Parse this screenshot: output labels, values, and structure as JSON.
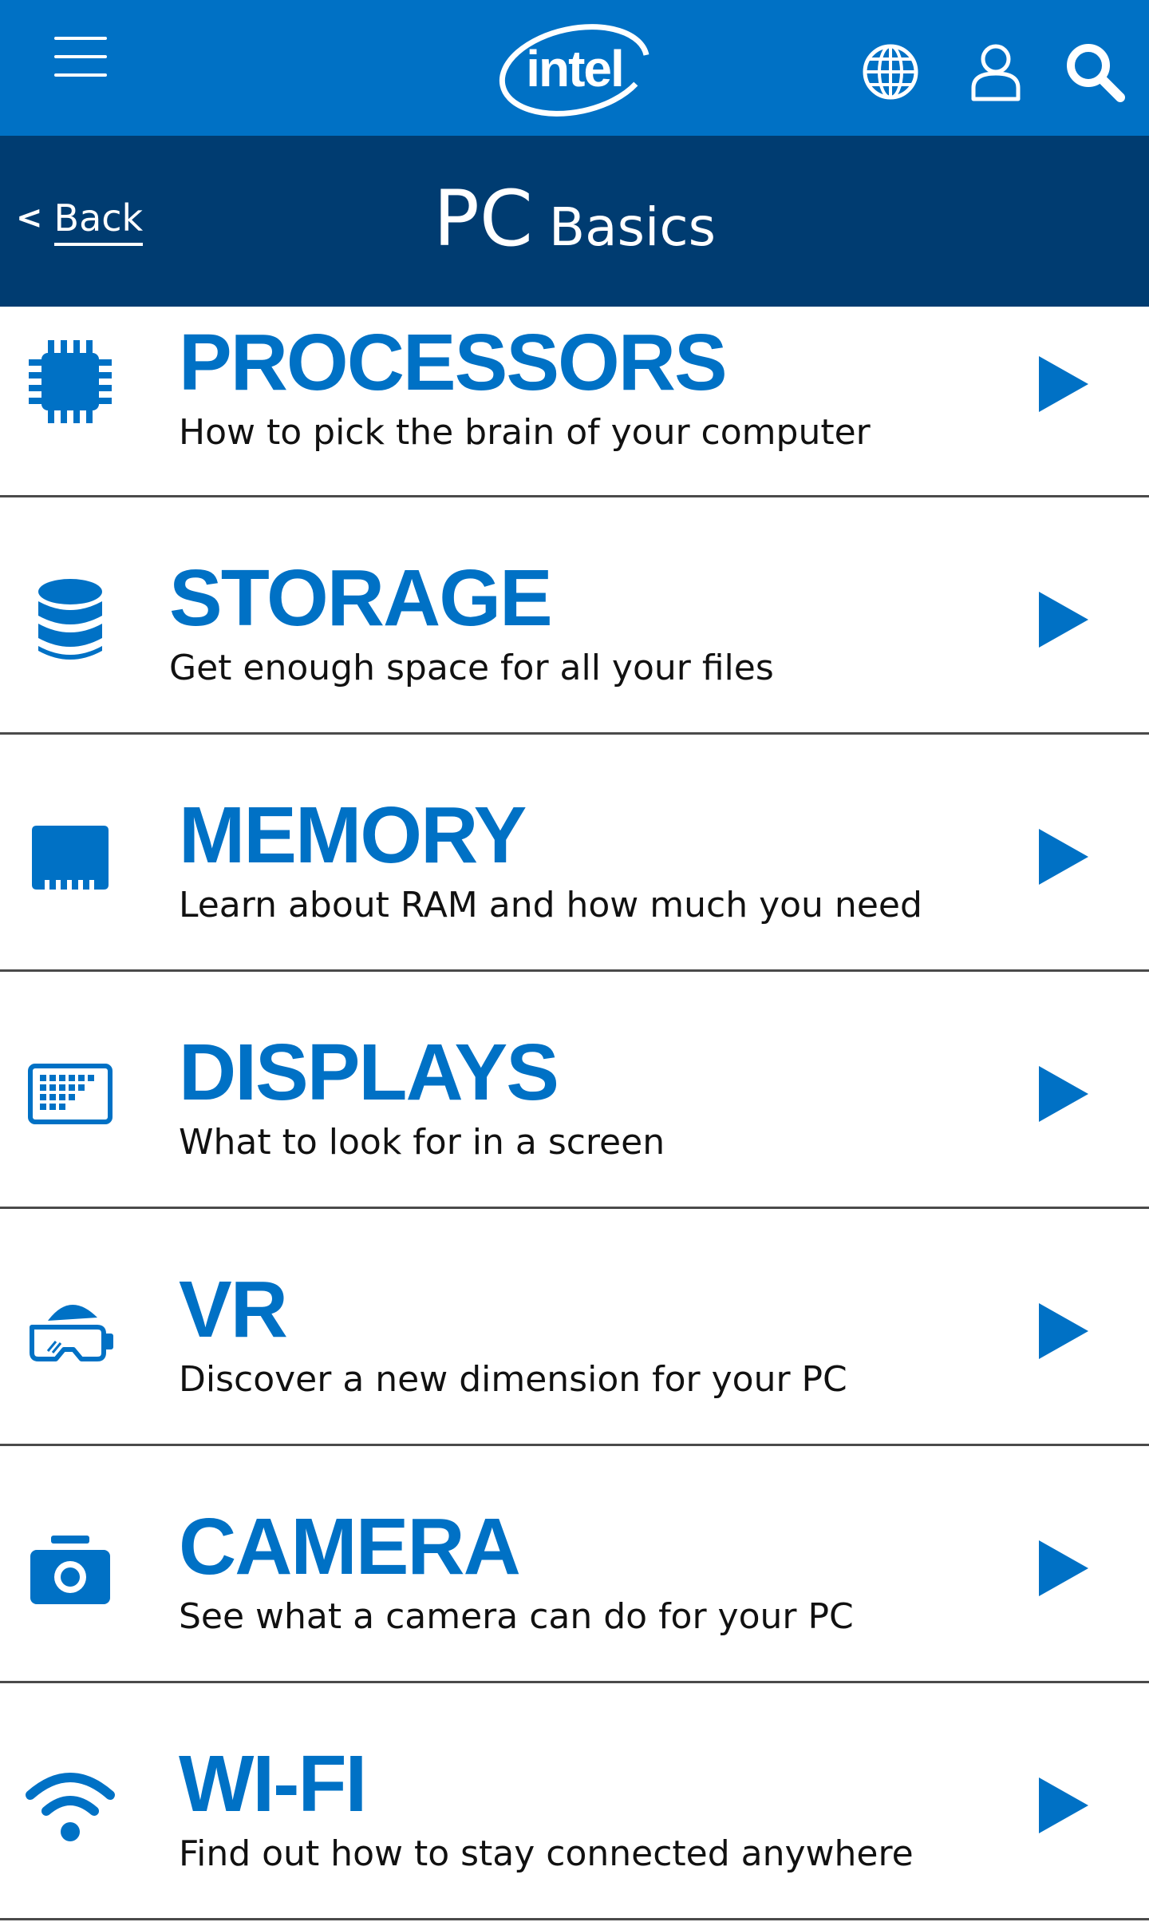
{
  "header": {
    "brand": "intel",
    "icons": [
      "menu-icon",
      "globe-icon",
      "user-icon",
      "search-icon"
    ],
    "brand_color": "#0071c5"
  },
  "subheader": {
    "back_label": "Back",
    "back_chevron": "<",
    "title_main": "PC",
    "title_sub": "Basics",
    "background": "#003c71"
  },
  "items": [
    {
      "title": "PROCESSORS",
      "description": "How to pick the brain of your computer",
      "icon": "processor-icon"
    },
    {
      "title": "STORAGE",
      "description": "Get enough space for all your files",
      "icon": "storage-icon"
    },
    {
      "title": "MEMORY",
      "description": "Learn about RAM and how much you need",
      "icon": "memory-icon"
    },
    {
      "title": "DISPLAYS",
      "description": "What to look for in a screen",
      "icon": "display-icon"
    },
    {
      "title": "VR",
      "description": "Discover a new dimension for your PC",
      "icon": "vr-headset-icon"
    },
    {
      "title": "CAMERA",
      "description": "See what a camera can do for your PC",
      "icon": "camera-icon"
    },
    {
      "title": "WI-FI",
      "description": "Find out how to stay connected anywhere",
      "icon": "wifi-icon"
    }
  ]
}
